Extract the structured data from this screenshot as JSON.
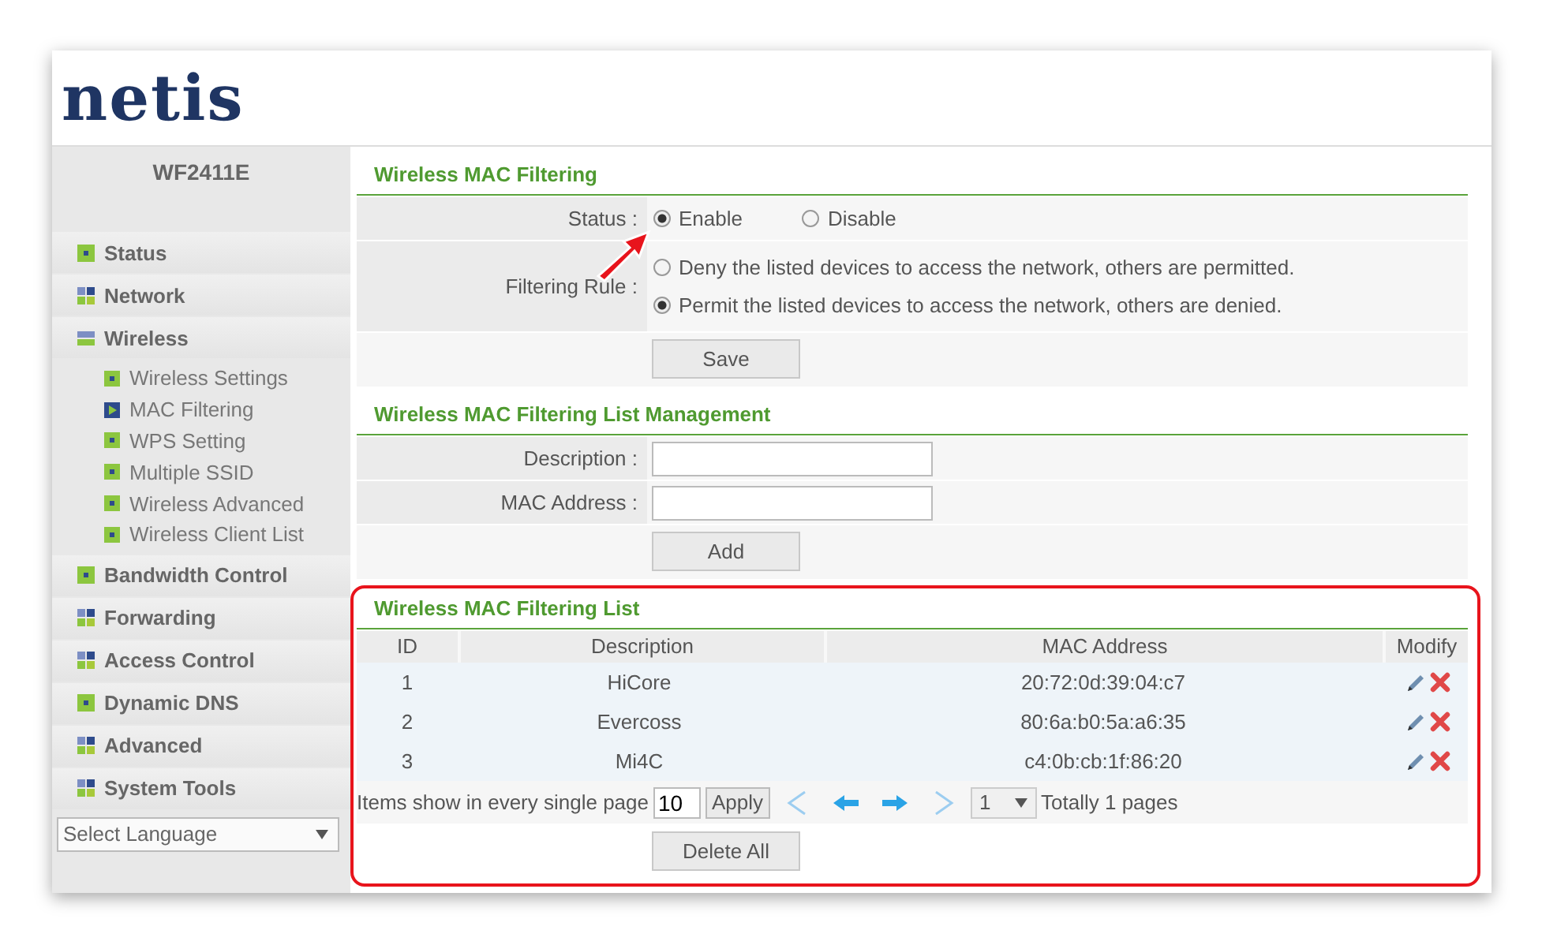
{
  "logo": "netis",
  "sidebar": {
    "model": "WF2411E",
    "items": [
      {
        "label": "Status",
        "kind": "page"
      },
      {
        "label": "Network",
        "kind": "group",
        "expanded": false
      },
      {
        "label": "Wireless",
        "kind": "group",
        "expanded": true,
        "children": [
          {
            "label": "Wireless Settings",
            "selected": false
          },
          {
            "label": "MAC Filtering",
            "selected": true
          },
          {
            "label": "WPS Setting",
            "selected": false
          },
          {
            "label": "Multiple SSID",
            "selected": false
          },
          {
            "label": "Wireless Advanced",
            "selected": false
          },
          {
            "label": "Wireless Client List",
            "selected": false
          }
        ]
      },
      {
        "label": "Bandwidth Control",
        "kind": "page"
      },
      {
        "label": "Forwarding",
        "kind": "group",
        "expanded": false
      },
      {
        "label": "Access Control",
        "kind": "group",
        "expanded": false
      },
      {
        "label": "Dynamic DNS",
        "kind": "page"
      },
      {
        "label": "Advanced",
        "kind": "group",
        "expanded": false
      },
      {
        "label": "System Tools",
        "kind": "group",
        "expanded": false
      }
    ],
    "language": "Select Language"
  },
  "filtering": {
    "title": "Wireless MAC Filtering",
    "status_label": "Status :",
    "status_options": [
      {
        "label": "Enable",
        "selected": true
      },
      {
        "label": "Disable",
        "selected": false
      }
    ],
    "rule_label": "Filtering Rule :",
    "rule_options": [
      {
        "label": "Deny the listed devices to access the network, others are permitted.",
        "selected": false
      },
      {
        "label": "Permit the listed devices to access the network, others are denied.",
        "selected": true
      }
    ],
    "save": "Save"
  },
  "management": {
    "title": "Wireless MAC Filtering List Management",
    "fields": [
      {
        "label": "Description :"
      },
      {
        "label": "MAC Address :"
      }
    ],
    "add": "Add"
  },
  "list": {
    "title": "Wireless MAC Filtering List",
    "columns": [
      "ID",
      "Description",
      "MAC Address",
      "Modify"
    ],
    "rows": [
      {
        "id": "1",
        "description": "HiCore",
        "mac": "20:72:0d:39:04:c7"
      },
      {
        "id": "2",
        "description": "Evercoss",
        "mac": "80:6a:b0:5a:a6:35"
      },
      {
        "id": "3",
        "description": "Mi4C",
        "mac": "c4:0b:cb:1f:86:20"
      }
    ],
    "per_page_label": "Items show in every single page",
    "per_page": "10",
    "apply": "Apply",
    "page": "1",
    "total": "Totally 1 pages",
    "delete_all": "Delete All"
  }
}
